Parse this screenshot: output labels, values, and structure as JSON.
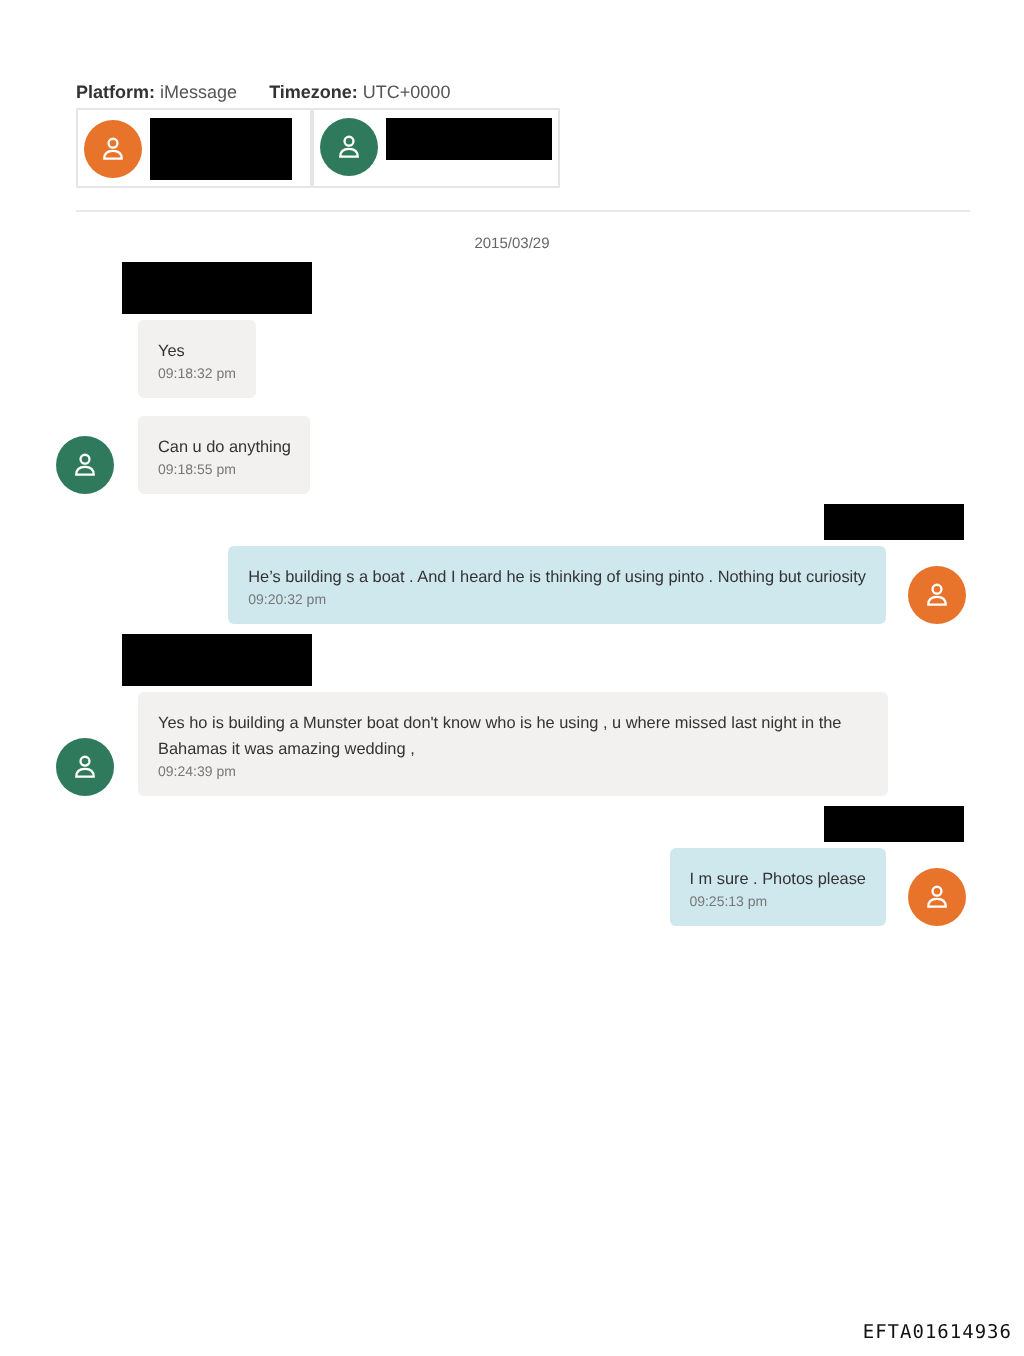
{
  "header": {
    "platform_label": "Platform:",
    "platform": "iMessage",
    "timezone_label": "Timezone:",
    "timezone": "UTC+0000"
  },
  "participants": [
    {
      "color": "#e8732a",
      "name_redacted": true
    },
    {
      "color": "#2f7a5c",
      "name_redacted": true
    }
  ],
  "date": "2015/03/29",
  "messages": [
    {
      "kind": "incoming",
      "name_redacted": true,
      "show_avatar": false,
      "text": "Yes",
      "time": "09:18:32 pm"
    },
    {
      "kind": "incoming",
      "name_redacted": false,
      "show_avatar": true,
      "text": "Can u do anything",
      "time": "09:18:55 pm"
    },
    {
      "kind": "outgoing",
      "name_redacted": true,
      "show_avatar": true,
      "text": "He’s building s a boat . And I heard  he is thinking of using pinto . Nothing but curiosity",
      "time": "09:20:32 pm"
    },
    {
      "kind": "incoming",
      "name_redacted": true,
      "show_avatar": true,
      "text": "Yes ho is building a Munster boat don't know who is he using , u where missed last night in the Bahamas it was amazing wedding ,",
      "time": "09:24:39 pm"
    },
    {
      "kind": "outgoing",
      "name_redacted": true,
      "show_avatar": true,
      "text": "I m sure . Photos please",
      "time": "09:25:13 pm"
    }
  ],
  "stamp": "EFTA01614936"
}
